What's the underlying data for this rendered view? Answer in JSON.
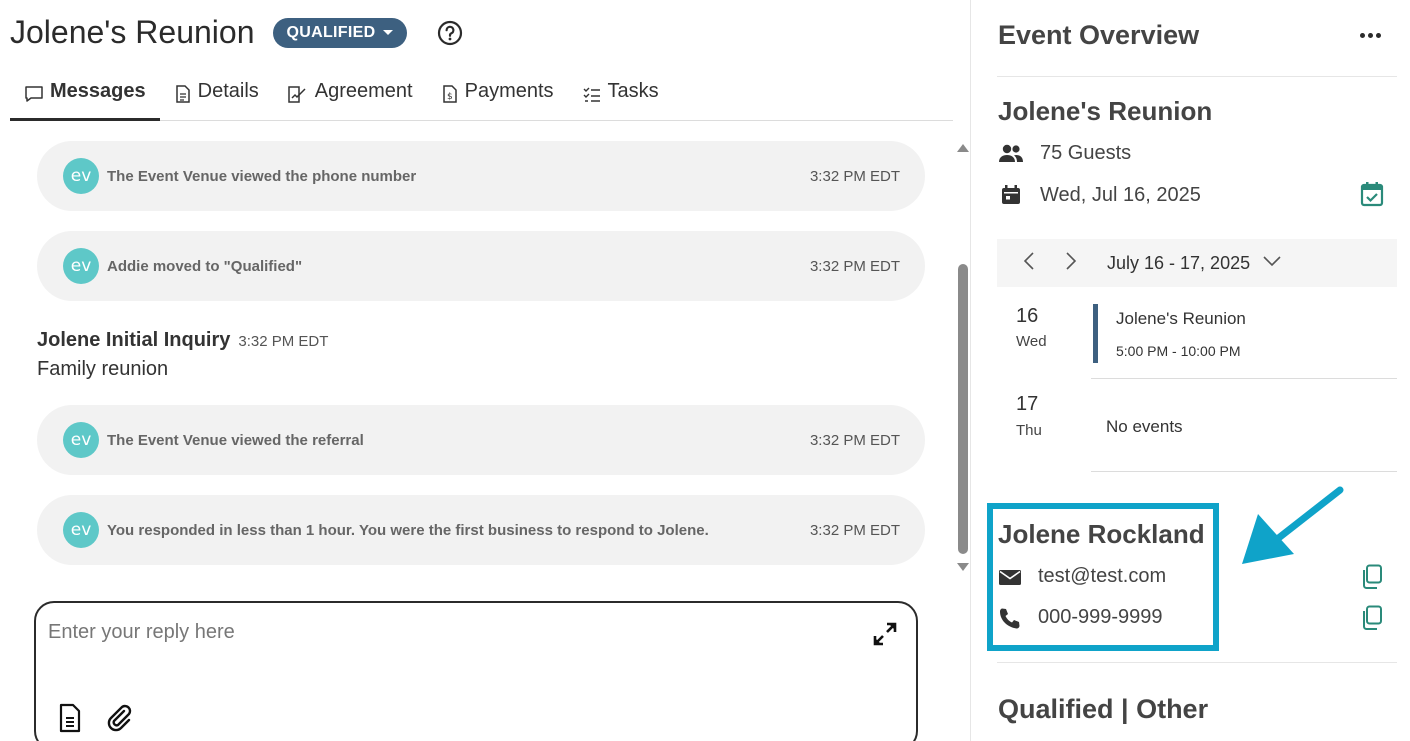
{
  "header": {
    "title": "Jolene's Reunion",
    "status": "QUALIFIED"
  },
  "tabs": [
    {
      "label": "Messages",
      "icon": "chat-bubble-icon",
      "active": true
    },
    {
      "label": "Details",
      "icon": "document-icon",
      "active": false
    },
    {
      "label": "Agreement",
      "icon": "signature-icon",
      "active": false
    },
    {
      "label": "Payments",
      "icon": "invoice-dollar-icon",
      "active": false
    },
    {
      "label": "Tasks",
      "icon": "checklist-icon",
      "active": false
    }
  ],
  "messages": {
    "logo_text": "ev",
    "system": [
      {
        "text": "The Event Venue viewed the phone number",
        "time": "3:32 PM EDT"
      },
      {
        "text": "Addie moved to \"Qualified\"",
        "time": "3:32 PM EDT"
      },
      {
        "text": "The Event Venue viewed the referral",
        "time": "3:32 PM EDT"
      },
      {
        "text": "You responded in less than 1 hour. You were the first business to respond to Jolene.",
        "time": "3:32 PM EDT"
      }
    ],
    "inquiry": {
      "name": "Jolene Initial Inquiry",
      "time": "3:32 PM EDT",
      "body": "Family reunion"
    }
  },
  "reply": {
    "placeholder": "Enter your reply here"
  },
  "overview": {
    "title": "Event Overview",
    "event_name": "Jolene's Reunion",
    "guests": "75 Guests",
    "date": "Wed, Jul 16, 2025",
    "calendar": {
      "range": "July 16 - 17, 2025",
      "days": [
        {
          "num": "16",
          "name": "Wed",
          "event_title": "Jolene's Reunion",
          "event_time": "5:00 PM - 10:00 PM"
        },
        {
          "num": "17",
          "name": "Thu",
          "no_events": "No events"
        }
      ]
    },
    "contact": {
      "name": "Jolene Rockland",
      "email": "test@test.com",
      "phone": "000-999-9999"
    },
    "stage": "Qualified | Other"
  },
  "colors": {
    "status_pill": "#3d6080",
    "ev_logo": "#5ec8c8",
    "highlight": "#0fa3c9",
    "calendar_check": "#2a8a7a"
  }
}
